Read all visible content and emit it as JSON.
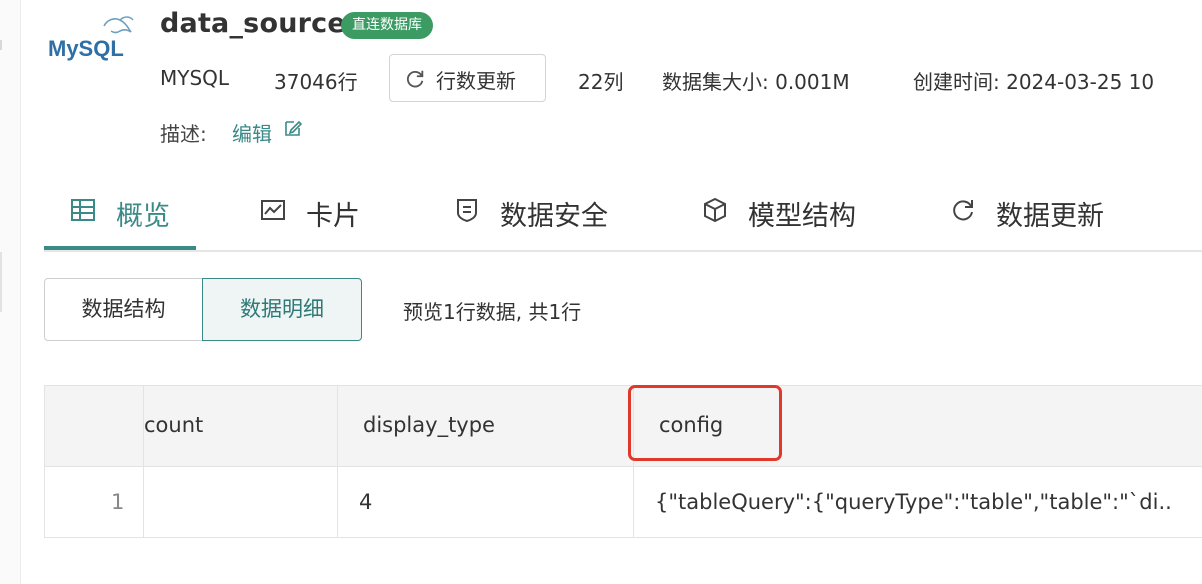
{
  "header": {
    "logo_text": "MySQL",
    "name": "data_source",
    "badge": "直连数据库",
    "db_type": "MYSQL",
    "rows": "37046行",
    "refresh_label": "行数更新",
    "columns": "22列",
    "size": "数据集大小: 0.001M",
    "created": "创建时间: 2024-03-25 10",
    "desc_label": "描述:",
    "desc_edit": "编辑"
  },
  "tabs": [
    {
      "label": "概览",
      "icon": "table-icon",
      "active": true
    },
    {
      "label": "卡片",
      "icon": "chart-icon",
      "active": false
    },
    {
      "label": "数据安全",
      "icon": "shield-icon",
      "active": false
    },
    {
      "label": "模型结构",
      "icon": "cube-icon",
      "active": false
    },
    {
      "label": "数据更新",
      "icon": "refresh-icon",
      "active": false
    }
  ],
  "subview": {
    "segments": [
      "数据结构",
      "数据明细"
    ],
    "selected": "数据明细",
    "note": "预览1行数据, 共1行"
  },
  "table": {
    "headers": [
      "count",
      "display_type",
      "config"
    ],
    "rows": [
      {
        "index": "1",
        "count": "",
        "display_type": "4",
        "config": "{\"tableQuery\":{\"queryType\":\"table\",\"table\":\"`di.."
      }
    ],
    "highlighted_column": "config"
  },
  "colors": {
    "accent": "#3a8a87",
    "badge": "#3b9b63",
    "highlight": "#e0392b"
  }
}
